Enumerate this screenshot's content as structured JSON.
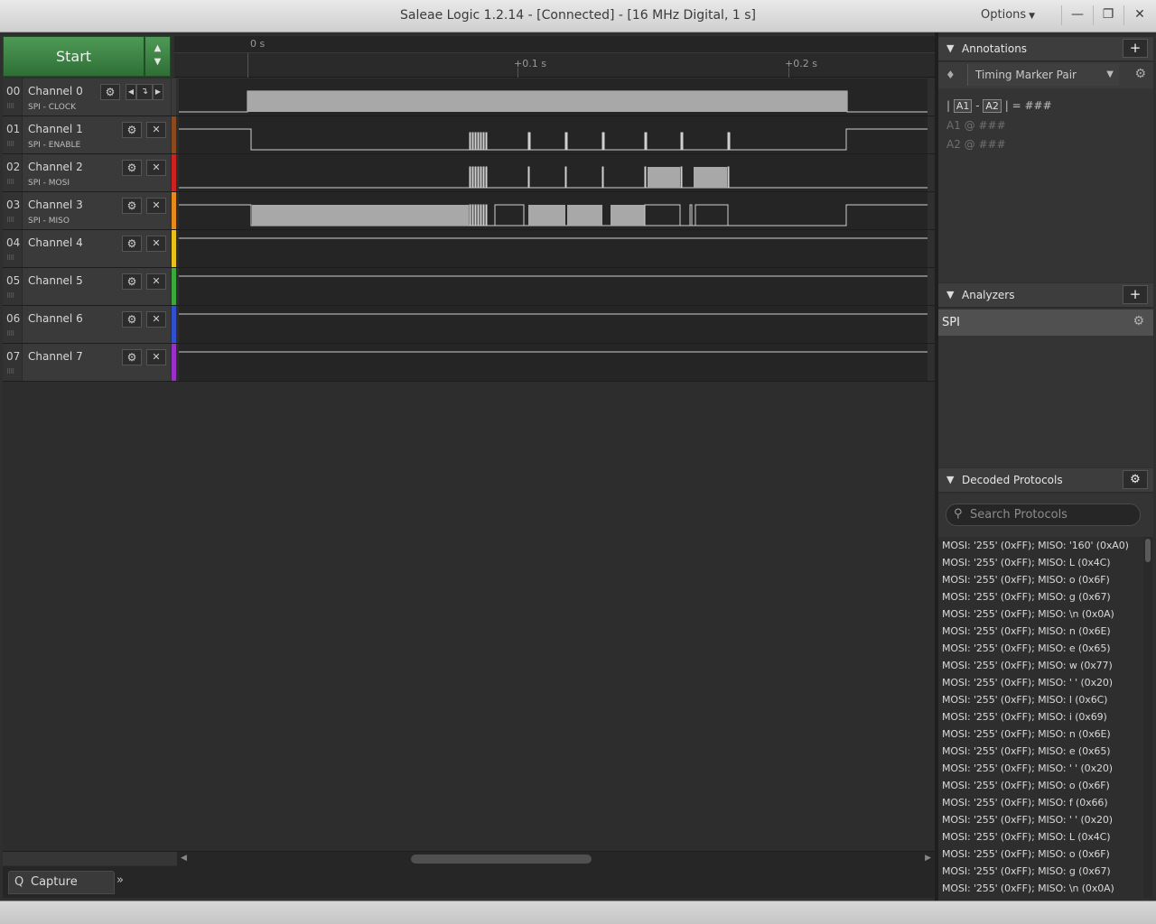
{
  "window": {
    "title": "Saleae Logic 1.2.14 - [Connected] - [16 MHz Digital, 1 s]",
    "options_label": "Options",
    "minimize": "—",
    "restore": "❐",
    "close": "✕"
  },
  "capture": {
    "start_label": "Start",
    "up_arrow": "▲",
    "down_arrow": "▼"
  },
  "ruler": {
    "t0": "0 s",
    "t1": "+0.1 s",
    "t2": "+0.2 s"
  },
  "channels": [
    {
      "num": "00",
      "name": "Channel 0",
      "sub": "SPI - CLOCK",
      "color": "#3a3a3a"
    },
    {
      "num": "01",
      "name": "Channel 1",
      "sub": "SPI - ENABLE",
      "color": "#8a4a1e"
    },
    {
      "num": "02",
      "name": "Channel 2",
      "sub": "SPI - MOSI",
      "color": "#d02020"
    },
    {
      "num": "03",
      "name": "Channel 3",
      "sub": "SPI - MISO",
      "color": "#e88a1a"
    },
    {
      "num": "04",
      "name": "Channel 4",
      "sub": "",
      "color": "#e8c21a"
    },
    {
      "num": "05",
      "name": "Channel 5",
      "sub": "",
      "color": "#3aa83a"
    },
    {
      "num": "06",
      "name": "Channel 6",
      "sub": "",
      "color": "#3050d0"
    },
    {
      "num": "07",
      "name": "Channel 7",
      "sub": "",
      "color": "#9a30c8"
    }
  ],
  "icons": {
    "gear": "⚙",
    "close": "✕",
    "edge": "↴",
    "prev": "◀",
    "next": "▶",
    "plus": "+",
    "triangle_down": "▼",
    "pin": "📍",
    "search": "🔍",
    "grip": "⠿⠿",
    "more": "»",
    "capture_icon": "Q"
  },
  "annotations": {
    "header": "Annotations",
    "marker_select": "Timing Marker Pair",
    "line1_left": "|",
    "line1_a1": "A1",
    "line1_dash": "-",
    "line1_a2": "A2",
    "line1_right": "| = ###",
    "line2": "A1  @  ###",
    "line3": "A2  @  ###"
  },
  "analyzers": {
    "header": "Analyzers",
    "items": [
      "SPI"
    ]
  },
  "decoded": {
    "header": "Decoded Protocols",
    "search_placeholder": "Search Protocols",
    "rows": [
      "MOSI: '255' (0xFF);  MISO: '160' (0xA0)",
      "MOSI: '255' (0xFF);  MISO: L (0x4C)",
      "MOSI: '255' (0xFF);  MISO: o (0x6F)",
      "MOSI: '255' (0xFF);  MISO: g (0x67)",
      "MOSI: '255' (0xFF);  MISO: \\n (0x0A)",
      "MOSI: '255' (0xFF);  MISO: n (0x6E)",
      "MOSI: '255' (0xFF);  MISO: e (0x65)",
      "MOSI: '255' (0xFF);  MISO: w (0x77)",
      "MOSI: '255' (0xFF);  MISO: ' ' (0x20)",
      "MOSI: '255' (0xFF);  MISO: l (0x6C)",
      "MOSI: '255' (0xFF);  MISO: i (0x69)",
      "MOSI: '255' (0xFF);  MISO: n (0x6E)",
      "MOSI: '255' (0xFF);  MISO: e (0x65)",
      "MOSI: '255' (0xFF);  MISO: ' ' (0x20)",
      "MOSI: '255' (0xFF);  MISO: o (0x6F)",
      "MOSI: '255' (0xFF);  MISO: f (0x66)",
      "MOSI: '255' (0xFF);  MISO: ' ' (0x20)",
      "MOSI: '255' (0xFF);  MISO: L (0x4C)",
      "MOSI: '255' (0xFF);  MISO: o (0x6F)",
      "MOSI: '255' (0xFF);  MISO: g (0x67)",
      "MOSI: '255' (0xFF);  MISO: \\n (0x0A)"
    ]
  },
  "bottom": {
    "capture_tab": "Capture"
  }
}
